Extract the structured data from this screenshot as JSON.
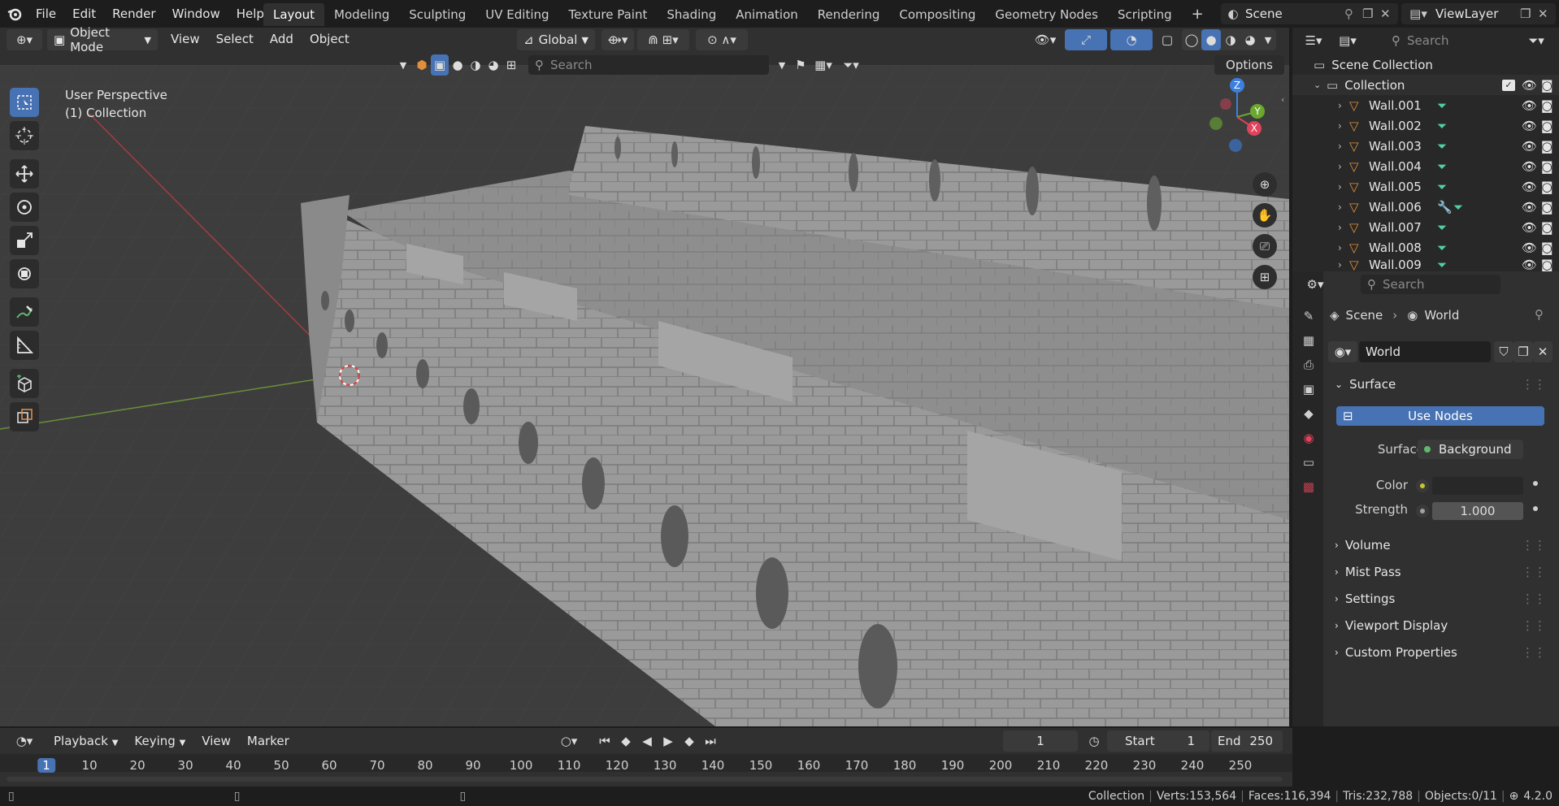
{
  "topbar": {
    "menus": [
      "File",
      "Edit",
      "Render",
      "Window",
      "Help"
    ],
    "workspaces": [
      "Layout",
      "Modeling",
      "Sculpting",
      "UV Editing",
      "Texture Paint",
      "Shading",
      "Animation",
      "Rendering",
      "Compositing",
      "Geometry Nodes",
      "Scripting"
    ],
    "active_workspace": "Layout",
    "scene": "Scene",
    "view_layer": "ViewLayer"
  },
  "viewport_header": {
    "mode": "Object Mode",
    "menus": [
      "View",
      "Select",
      "Add",
      "Object"
    ],
    "orientation": "Global",
    "search_placeholder": "Search",
    "options": "Options"
  },
  "viewport": {
    "perspective": "User Perspective",
    "collection": "(1) Collection",
    "gizmo": {
      "x": "X",
      "y": "Y",
      "z": "Z"
    }
  },
  "outliner": {
    "search_placeholder": "Search",
    "scene_collection": "Scene Collection",
    "collection": "Collection",
    "items": [
      "Wall.001",
      "Wall.002",
      "Wall.003",
      "Wall.004",
      "Wall.005",
      "Wall.006",
      "Wall.007",
      "Wall.008",
      "Wall.009"
    ]
  },
  "properties": {
    "search_placeholder": "Search",
    "breadcrumb": {
      "scene": "Scene",
      "world": "World"
    },
    "world_name": "World",
    "surface_panel": "Surface",
    "use_nodes": "Use Nodes",
    "surface_label": "Surface",
    "surface_value": "Background",
    "color_label": "Color",
    "strength_label": "Strength",
    "strength_value": "1.000",
    "panels": [
      "Volume",
      "Mist Pass",
      "Settings",
      "Viewport Display",
      "Custom Properties"
    ]
  },
  "timeline": {
    "menus": [
      "Playback",
      "Keying",
      "View",
      "Marker"
    ],
    "current_frame": "1",
    "start_label": "Start",
    "start": "1",
    "end_label": "End",
    "end": "250",
    "ticks": [
      "1",
      "10",
      "20",
      "30",
      "40",
      "50",
      "60",
      "70",
      "80",
      "90",
      "100",
      "110",
      "120",
      "130",
      "140",
      "150",
      "160",
      "170",
      "180",
      "190",
      "200",
      "210",
      "220",
      "230",
      "240",
      "250"
    ]
  },
  "statusbar": {
    "collection": "Collection",
    "verts": "Verts:153,564",
    "faces": "Faces:116,394",
    "tris": "Tris:232,788",
    "objects": "Objects:0/11",
    "version": "4.2.0"
  },
  "colors": {
    "accent": "#4772b3",
    "mesh_icon": "#e0903a",
    "data_icon": "#4fd1a0"
  }
}
